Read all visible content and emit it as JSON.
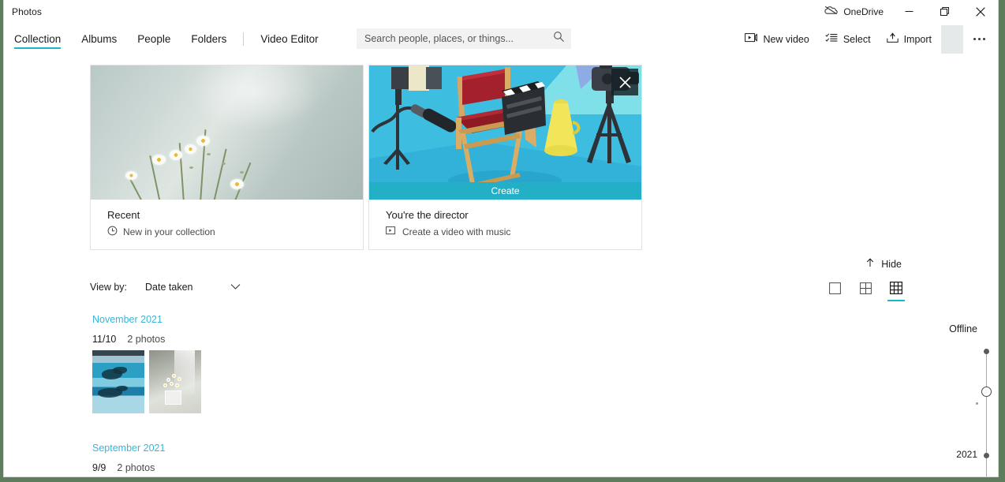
{
  "window": {
    "app_title": "Photos",
    "onedrive_label": "OneDrive",
    "minimize_label": "Minimize",
    "restore_label": "Restore",
    "close_label": "Close"
  },
  "nav": {
    "tabs": [
      {
        "label": "Collection",
        "active": true
      },
      {
        "label": "Albums",
        "active": false
      },
      {
        "label": "People",
        "active": false
      },
      {
        "label": "Folders",
        "active": false
      },
      {
        "label": "Video Editor",
        "active": false
      }
    ]
  },
  "search": {
    "placeholder": "Search people, places, or things...",
    "value": ""
  },
  "toolbar": {
    "new_video_label": "New video",
    "select_label": "Select",
    "import_label": "Import",
    "more_label": "See more"
  },
  "cards": [
    {
      "title": "Recent",
      "subtitle": "New in your collection",
      "icon": "clock-icon"
    },
    {
      "title": "You're the director",
      "subtitle": "Create a video with music",
      "icon": "video-icon",
      "banner": "Create",
      "close_label": "Close"
    }
  ],
  "controls": {
    "hide_label": "Hide",
    "view_by_label": "View by:",
    "view_by_value": "Date taken",
    "zoom_levels": [
      {
        "name": "single-large",
        "active": false
      },
      {
        "name": "medium-grid",
        "active": false
      },
      {
        "name": "small-grid",
        "active": true
      }
    ]
  },
  "sections": [
    {
      "month": "November 2021",
      "date": "11/10",
      "count": "2 photos",
      "photos": [
        "ice-lake-photo",
        "white-flowers-vase-photo"
      ]
    },
    {
      "month": "September 2021",
      "date": "9/9",
      "count": "2 photos",
      "photos": []
    }
  ],
  "timeline": {
    "status": "Offline",
    "year": "2021"
  },
  "colors": {
    "accent": "#1bb8c8",
    "link": "#3bb4d6",
    "banner": "#23b0c6",
    "window_border": "#5d7d5d"
  }
}
